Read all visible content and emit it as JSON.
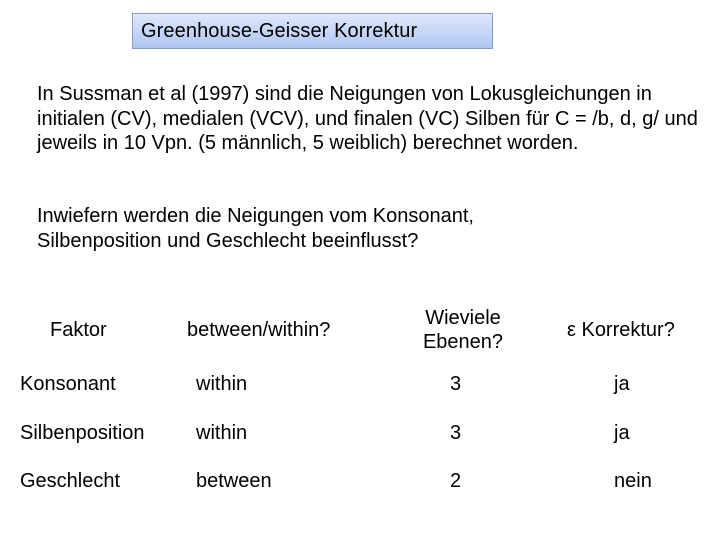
{
  "slide": {
    "title": "Greenhouse-Geisser Korrektur",
    "paragraphs": [
      "In Sussman et al (1997) sind die Neigungen von Lokusgleichungen in initialen (CV), medialen (VCV), und finalen (VC) Silben für C = /b, d, g/ und jeweils in 10 Vpn. (5 männlich, 5 weiblich) berechnet worden.",
      "Inwiefern werden die Neigungen vom Konsonant, Silbenposition und Geschlecht beeinflusst?"
    ],
    "colors": {
      "title_box_top": "#dfe8fb",
      "title_box_bottom": "#aec4f1",
      "title_box_border": "#8a9cc0"
    }
  },
  "table": {
    "headers": {
      "faktor": "Faktor",
      "between_within": "between/within?",
      "ebenen_line1": "Wieviele",
      "ebenen_line2": "Ebenen?",
      "epsilon": "ε Korrektur?"
    },
    "rows": [
      {
        "faktor": "Konsonant",
        "between_within": "within",
        "ebenen": "3",
        "korrektur": "ja"
      },
      {
        "faktor": "Silbenposition",
        "between_within": "within",
        "ebenen": "3",
        "korrektur": "ja"
      },
      {
        "faktor": "Geschlecht",
        "between_within": "between",
        "ebenen": "2",
        "korrektur": "nein"
      }
    ]
  }
}
